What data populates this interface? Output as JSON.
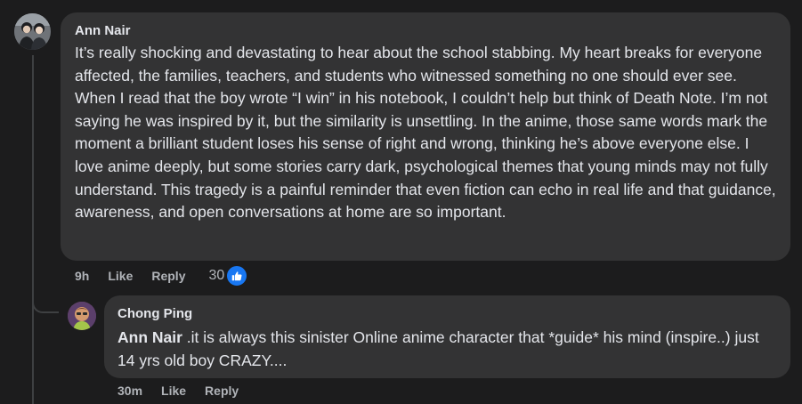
{
  "comment": {
    "author": "Ann Nair",
    "text": "It’s really shocking and devastating to hear about the school stabbing. My heart breaks for everyone affected, the families, teachers, and students who witnessed something no one should ever see. When I read that the boy wrote “I win” in his notebook, I couldn’t help but think of Death Note. I’m not saying he was inspired by it, but the similarity is unsettling. In the anime, those same words mark the moment a brilliant student loses his sense of right and wrong, thinking he’s above everyone else. I love anime deeply, but some stories carry dark, psychological themes that young minds may not fully understand. This tragedy is a painful reminder that even fiction can echo in real life and that guidance, awareness, and open conversations at home are so important.",
    "time": "9h",
    "like_label": "Like",
    "reply_label": "Reply",
    "reaction_count": "30",
    "reaction_icon": "thumbs-up-icon",
    "reaction_color": "#1877f2"
  },
  "reply": {
    "author": "Chong Ping",
    "mention": "Ann Nair",
    "text": " .it is always this sinister Online anime character that *guide* his mind (inspire..) just 14 yrs old boy CRAZY....",
    "time": "30m",
    "like_label": "Like",
    "reply_label": "Reply"
  }
}
